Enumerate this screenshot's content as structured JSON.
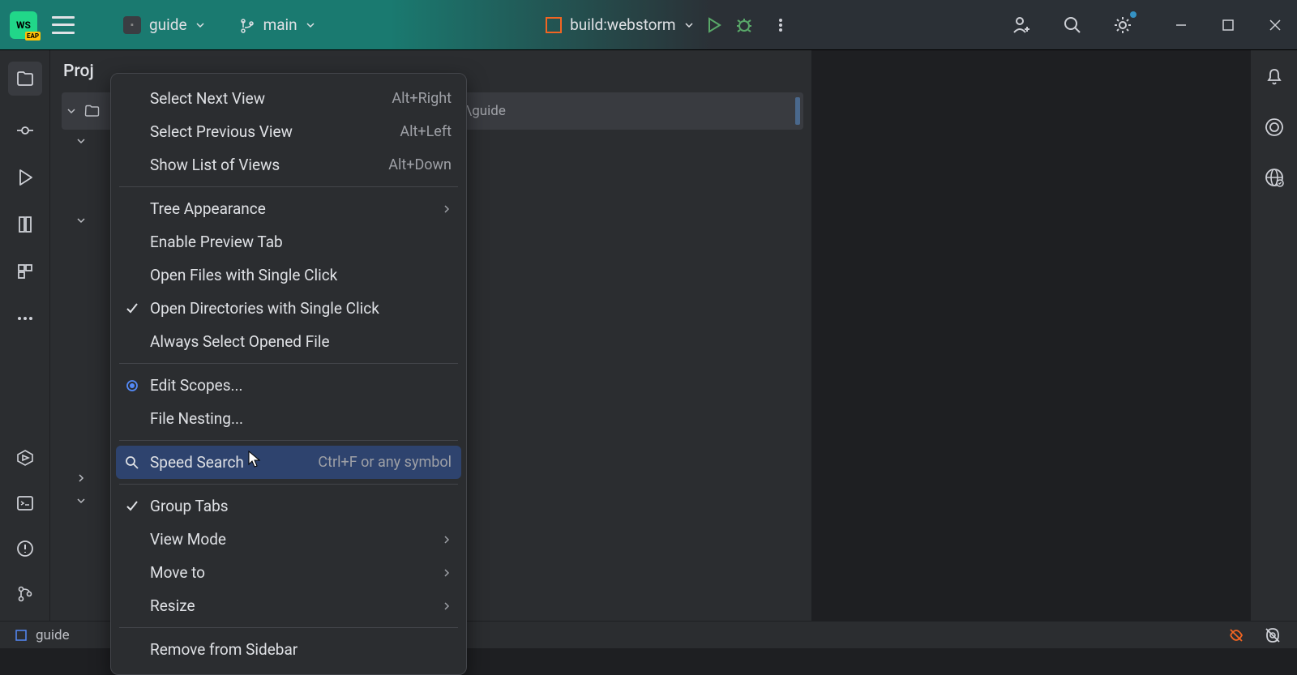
{
  "titlebar": {
    "app_icon_label": "WS",
    "project_name": "guide",
    "branch_name": "main",
    "run_config": "build:webstorm"
  },
  "project_panel": {
    "title": "Proj",
    "root_path_hint": "cts\\guide"
  },
  "context_menu": {
    "items": [
      {
        "label": "Select Next View",
        "shortcut": "Alt+Right"
      },
      {
        "label": "Select Previous View",
        "shortcut": "Alt+Left"
      },
      {
        "label": "Show List of Views",
        "shortcut": "Alt+Down"
      }
    ],
    "group2": [
      {
        "label": "Tree Appearance",
        "submenu": true
      },
      {
        "label": "Enable Preview Tab"
      },
      {
        "label": "Open Files with Single Click"
      },
      {
        "label": "Open Directories with Single Click",
        "checked": true
      },
      {
        "label": "Always Select Opened File"
      }
    ],
    "group3": [
      {
        "label": "Edit Scopes...",
        "radio": true
      },
      {
        "label": "File Nesting..."
      }
    ],
    "group4": [
      {
        "label": "Speed Search",
        "shortcut": "Ctrl+F or any symbol",
        "highlighted": true,
        "search_icon": true
      }
    ],
    "group5": [
      {
        "label": "Group Tabs",
        "checked": true
      },
      {
        "label": "View Mode",
        "submenu": true
      },
      {
        "label": "Move to",
        "submenu": true
      },
      {
        "label": "Resize",
        "submenu": true
      }
    ],
    "group6": [
      {
        "label": "Remove from Sidebar"
      }
    ]
  },
  "bottom_bar": {
    "breadcrumb": "guide"
  }
}
